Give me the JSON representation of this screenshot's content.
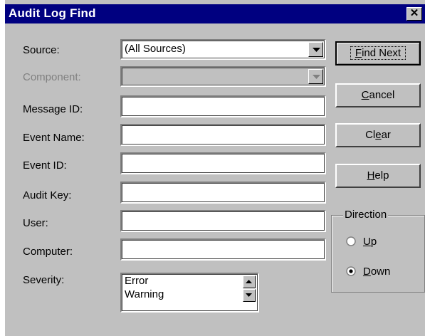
{
  "dialog": {
    "title": "Audit Log Find",
    "close_glyph": "✕"
  },
  "labels": {
    "source": "Source:",
    "component": "Component:",
    "message_id": "Message ID:",
    "event_name": "Event Name:",
    "event_id": "Event ID:",
    "audit_key": "Audit Key:",
    "user": "User:",
    "computer": "Computer:",
    "severity": "Severity:"
  },
  "fields": {
    "source_value": "(All Sources)",
    "component_value": "",
    "message_id_value": "",
    "event_name_value": "",
    "event_id_value": "",
    "audit_key_value": "",
    "user_value": "",
    "computer_value": ""
  },
  "severity_list": [
    "Error",
    "Warning"
  ],
  "buttons": {
    "find_next": {
      "u": "F",
      "rest": "ind Next"
    },
    "cancel": {
      "u": "C",
      "rest": "ancel"
    },
    "clear": {
      "pre": "Cl",
      "u": "e",
      "rest": "ar"
    },
    "help": {
      "u": "H",
      "rest": "elp"
    }
  },
  "direction": {
    "title": "Direction",
    "up": {
      "u": "U",
      "rest": "p",
      "selected": false
    },
    "down": {
      "u": "D",
      "rest": "own",
      "selected": true
    }
  },
  "icons": {
    "close": "close-icon",
    "dropdown": "dropdown-arrow-icon",
    "scroll_up": "scroll-up-icon",
    "scroll_down": "scroll-down-icon"
  },
  "colors": {
    "title_bar": "#000080",
    "face": "#c0c0c0",
    "disabled_text": "#808080"
  }
}
